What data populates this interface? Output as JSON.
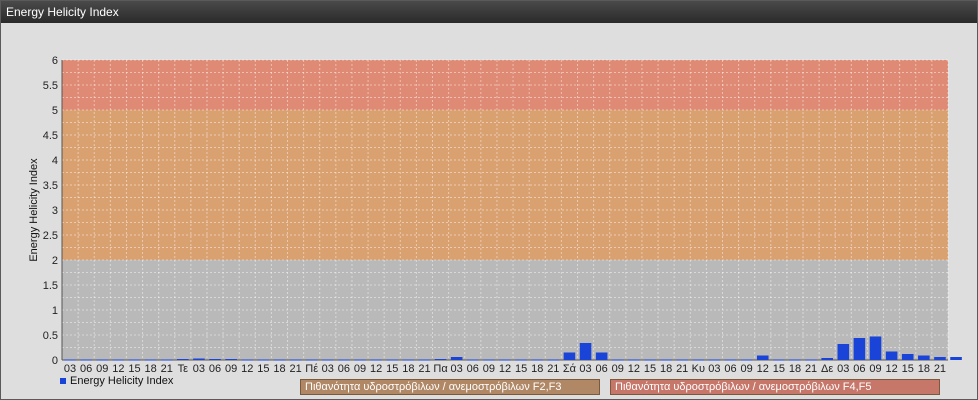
{
  "window": {
    "title": "Energy Helicity Index"
  },
  "legend": {
    "label": "Energy Helicity Index",
    "color": "#1a44d8"
  },
  "band_tags": [
    {
      "label": "Πιθανότητα υδροστρόβιλων / ανεμοστρόβιλων F2,F3",
      "color": "#b08866"
    },
    {
      "label": "Πιθανότητα υδροστρόβιλων / ανεμοστρόβιλων F4,F5",
      "color": "#c6776a"
    }
  ],
  "chart_data": {
    "type": "bar",
    "ylabel": "Energy Helicity Index",
    "xlabel": "",
    "ylim": [
      0,
      6
    ],
    "yticks": [
      "0",
      "0.5",
      "1",
      "1.5",
      "2",
      "2.5",
      "3",
      "3.5",
      "4",
      "4.5",
      "5",
      "5.5",
      "6"
    ],
    "grid": true,
    "bands": [
      {
        "from": 0,
        "to": 2,
        "color": "#b9b9b9"
      },
      {
        "from": 2,
        "to": 5,
        "color": "#d9a070"
      },
      {
        "from": 5,
        "to": 6,
        "color": "#df8a74"
      }
    ],
    "categories": [
      "03",
      "06",
      "09",
      "12",
      "15",
      "18",
      "21",
      "Τε",
      "03",
      "06",
      "09",
      "12",
      "15",
      "18",
      "21",
      "Πέ",
      "03",
      "06",
      "09",
      "12",
      "15",
      "18",
      "21",
      "Πα",
      "03",
      "06",
      "09",
      "12",
      "15",
      "18",
      "21",
      "Σά",
      "03",
      "06",
      "09",
      "12",
      "15",
      "18",
      "21",
      "Κυ",
      "03",
      "06",
      "09",
      "12",
      "15",
      "18",
      "21",
      "Δε",
      "03",
      "06",
      "09",
      "12",
      "15",
      "18",
      "21"
    ],
    "series": [
      {
        "name": "Energy Helicity Index",
        "color": "#1a44d8",
        "values": [
          0.01,
          0.01,
          0.01,
          0.01,
          0.01,
          0.01,
          0.01,
          0.02,
          0.03,
          0.02,
          0.02,
          0.01,
          0.01,
          0.01,
          0.01,
          0.01,
          0.01,
          0.01,
          0.01,
          0.01,
          0.01,
          0.01,
          0.01,
          0.02,
          0.06,
          0.01,
          0.01,
          0.01,
          0.01,
          0.01,
          0.01,
          0.15,
          0.34,
          0.15,
          0.01,
          0.01,
          0.01,
          0.01,
          0.01,
          0.01,
          0.01,
          0.01,
          0.01,
          0.09,
          0.01,
          0.01,
          0.01,
          0.04,
          0.32,
          0.44,
          0.47,
          0.17,
          0.12,
          0.09,
          0.06,
          0.06
        ]
      }
    ]
  }
}
